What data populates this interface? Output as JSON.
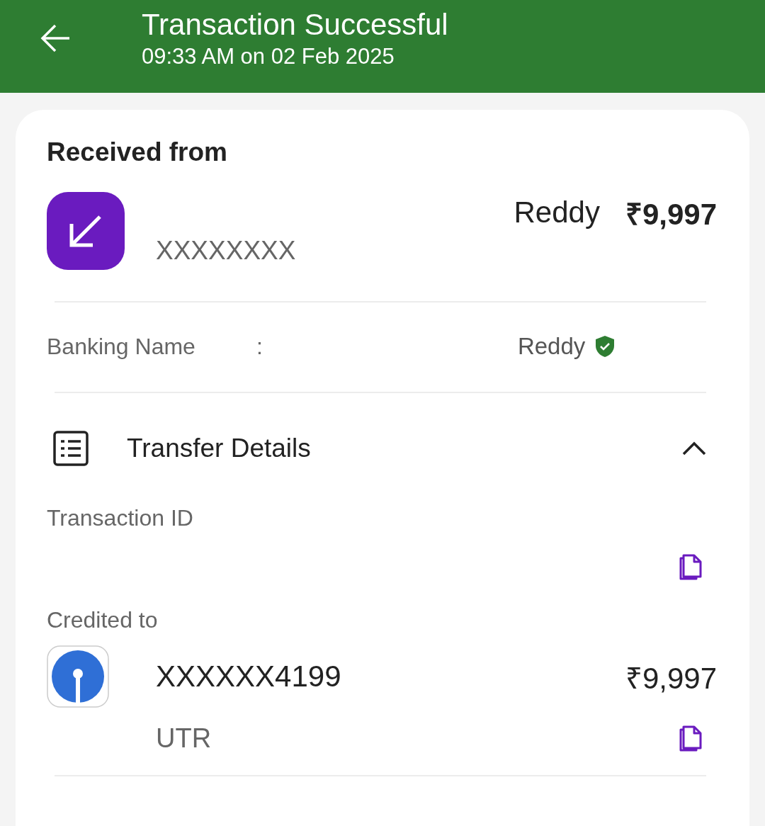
{
  "header": {
    "title": "Transaction Successful",
    "subtitle": "09:33 AM on 02 Feb 2025"
  },
  "received": {
    "heading": "Received from",
    "name": "Reddy",
    "amount": "₹9,997",
    "account": "XXXXXXXX"
  },
  "banking_name": {
    "label": "Banking Name",
    "separator": ":",
    "value": "Reddy",
    "verified": true
  },
  "transfer_details": {
    "title": "Transfer Details",
    "expanded": true,
    "transaction_id_label": "Transaction ID",
    "credited_label": "Credited to",
    "credited_account": "XXXXXX4199",
    "credited_amount": "₹9,997",
    "utr": "UTR"
  }
}
